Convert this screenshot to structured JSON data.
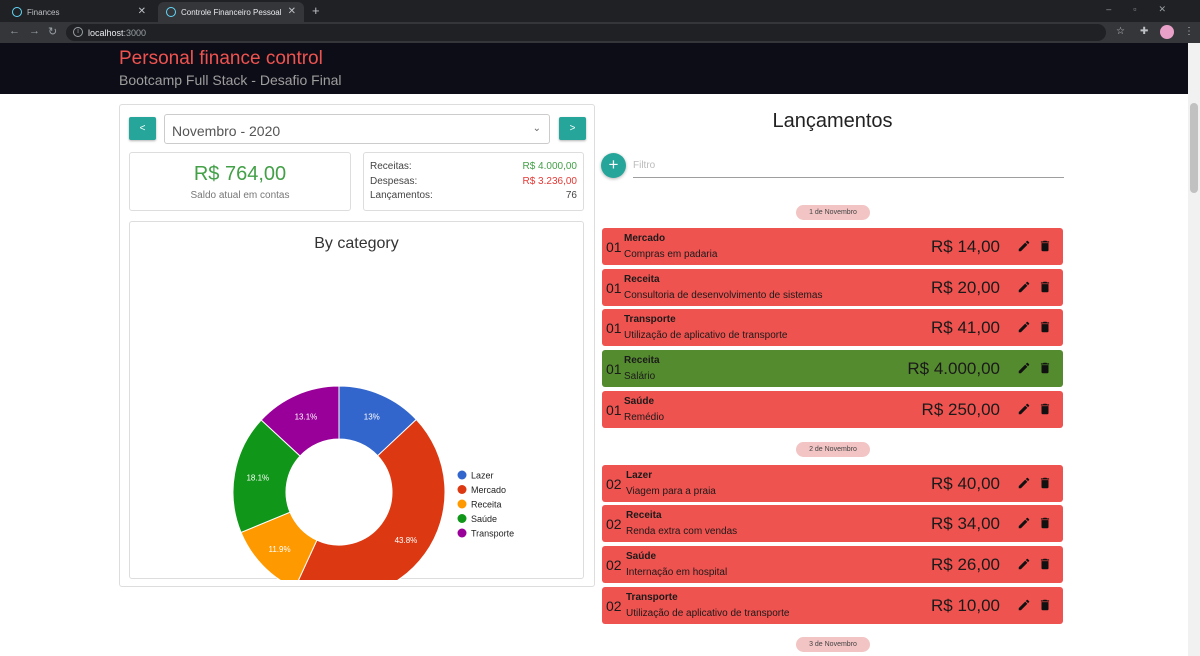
{
  "browser": {
    "tabs": [
      {
        "title": "Finances"
      },
      {
        "title": "Controle Financeiro Pessoal"
      }
    ],
    "url_host": "localhost",
    "url_port": ":3000"
  },
  "header": {
    "title": "Personal finance control",
    "subtitle": "Bootcamp Full Stack - Desafio Final"
  },
  "period": {
    "prev_label": "<",
    "next_label": ">",
    "selected": "Novembro - 2020"
  },
  "balance": {
    "value": "R$ 764,00",
    "label": "Saldo atual em contas"
  },
  "summary": {
    "receitas_label": "Receitas:",
    "receitas_value": "R$ 4.000,00",
    "despesas_label": "Despesas:",
    "despesas_value": "R$ 3.236,00",
    "lancamentos_label": "Lançamentos:",
    "lancamentos_value": "76"
  },
  "chart_data": {
    "type": "pie",
    "title": "By category",
    "categories": [
      "Lazer",
      "Mercado",
      "Receita",
      "Saúde",
      "Transporte"
    ],
    "values": [
      13,
      43.8,
      11.9,
      18.1,
      13.1
    ],
    "labels": [
      "13%",
      "43.8%",
      "11.9%",
      "18.1%",
      "13.1%"
    ],
    "colors": [
      "#3366cc",
      "#dc3912",
      "#ff9900",
      "#109618",
      "#990099"
    ],
    "donut": true,
    "legend": "right"
  },
  "transactions": {
    "title": "Lançamentos",
    "add_label": "+",
    "filter_placeholder": "Filtro",
    "groups": [
      {
        "label": "1 de Novembro",
        "items": [
          {
            "day": "01",
            "category": "Mercado",
            "description": "Compras em padaria",
            "value": "R$ 14,00",
            "type": "expense"
          },
          {
            "day": "01",
            "category": "Receita",
            "description": "Consultoria de desenvolvimento de sistemas",
            "value": "R$ 20,00",
            "type": "expense"
          },
          {
            "day": "01",
            "category": "Transporte",
            "description": "Utilização de aplicativo de transporte",
            "value": "R$ 41,00",
            "type": "expense"
          },
          {
            "day": "01",
            "category": "Receita",
            "description": "Salário",
            "value": "R$ 4.000,00",
            "type": "income"
          },
          {
            "day": "01",
            "category": "Saúde",
            "description": "Remédio",
            "value": "R$ 250,00",
            "type": "expense"
          }
        ]
      },
      {
        "label": "2 de Novembro",
        "items": [
          {
            "day": "02",
            "category": "Lazer",
            "description": "Viagem para a praia",
            "value": "R$ 40,00",
            "type": "expense"
          },
          {
            "day": "02",
            "category": "Receita",
            "description": "Renda extra com vendas",
            "value": "R$ 34,00",
            "type": "expense"
          },
          {
            "day": "02",
            "category": "Saúde",
            "description": "Internação em hospital",
            "value": "R$ 26,00",
            "type": "expense"
          },
          {
            "day": "02",
            "category": "Transporte",
            "description": "Utilização de aplicativo de transporte",
            "value": "R$ 10,00",
            "type": "expense"
          }
        ]
      },
      {
        "label": "3 de Novembro",
        "items": []
      }
    ]
  },
  "colors": {
    "accent": "#26a69a",
    "expense": "#ef5350",
    "income": "#558b2f",
    "balance_text": "#43a047",
    "header_bg": "#0d0d17",
    "title_text": "#ef5350"
  },
  "icons": {
    "edit": "pencil-icon",
    "delete": "trash-icon"
  }
}
